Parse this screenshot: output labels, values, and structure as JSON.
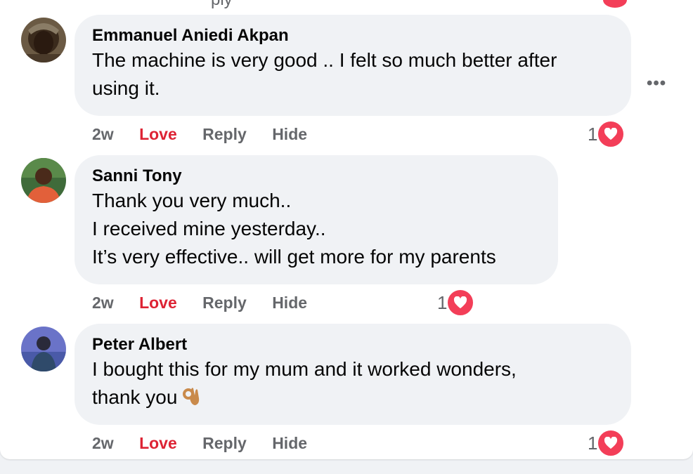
{
  "colors": {
    "love": "#dd2334",
    "heart": "#f33e58",
    "meta": "#65676b",
    "bubble": "#f0f2f5"
  },
  "top_partial": {
    "text": "ply"
  },
  "comments": [
    {
      "author": "Emmanuel Aniedi Akpan",
      "lines": [
        "The machine is very good .. I felt so much better after",
        "using it."
      ],
      "time": "2w",
      "love": "Love",
      "reply": "Reply",
      "hide": "Hide",
      "reaction_count": "1",
      "reaction_icon": "heart-icon",
      "menu_label": "•••"
    },
    {
      "author": "Sanni Tony",
      "lines": [
        "Thank you very much..",
        "I received mine yesterday..",
        "It’s very effective.. will get more for my parents"
      ],
      "time": "2w",
      "love": "Love",
      "reply": "Reply",
      "hide": "Hide",
      "reaction_count": "1",
      "reaction_icon": "heart-icon"
    },
    {
      "author": "Peter Albert",
      "lines": [
        "I bought this for my mum and it worked wonders,",
        "thank you"
      ],
      "emoji": "ok-hand-icon",
      "time": "2w",
      "love": "Love",
      "reply": "Reply",
      "hide": "Hide",
      "reaction_count": "1",
      "reaction_icon": "heart-icon"
    }
  ]
}
